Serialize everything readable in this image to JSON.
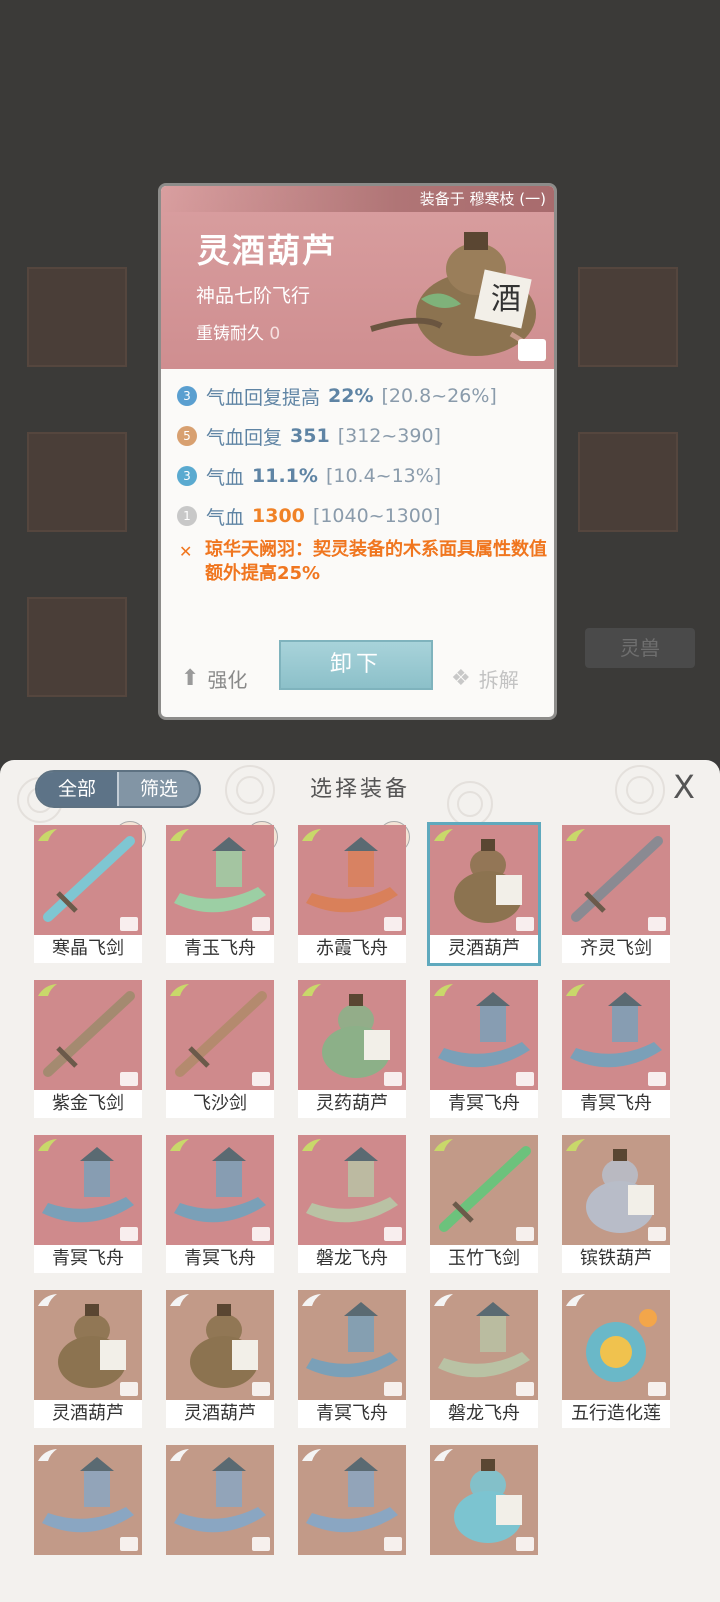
{
  "detail": {
    "equipped_by": "装备于 穆寒枝 (一)",
    "name": "灵酒葫芦",
    "grade": "神品七阶飞行",
    "durability_label": "重铸耐久",
    "durability_value": "0",
    "stats": [
      {
        "badge": "3",
        "badge_color": "#5a9fd0",
        "label": "气血回复提高",
        "value": "22%",
        "range": "[20.8~26%]",
        "value_color": "#5f84a4"
      },
      {
        "badge": "5",
        "badge_color": "#d8a070",
        "label": "气血回复",
        "value": "351",
        "range": "[312~390]",
        "value_color": "#5f84a4"
      },
      {
        "badge": "3",
        "badge_color": "#5aaad0",
        "label": "气血",
        "value": "11.1%",
        "range": "[10.4~13%]",
        "value_color": "#5f84a4"
      },
      {
        "badge": "1",
        "badge_color": "#c8c8c8",
        "label": "气血",
        "value": "1300",
        "range": "[1040~1300]",
        "value_color": "#f08227"
      }
    ],
    "special": "琼华天阙羽：契灵装备的木系面具属性数值额外提高25%",
    "strengthen": "强化",
    "unload": "卸下",
    "dismantle": "拆解"
  },
  "background": {
    "tag": "灵兽"
  },
  "panel": {
    "tab_all": "全部",
    "tab_filter": "筛选",
    "title": "选择装备",
    "close": "X"
  },
  "items": [
    {
      "name": "寒晶飞剑",
      "bg": "#cf8a8c",
      "kind": "sword",
      "tint": "#7fc6d2",
      "avatar": true
    },
    {
      "name": "青玉飞舟",
      "bg": "#cf8a8c",
      "kind": "boat",
      "tint": "#9ccfa4",
      "avatar": true
    },
    {
      "name": "赤霞飞舟",
      "bg": "#cf8a8c",
      "kind": "boat",
      "tint": "#d9805a",
      "avatar": true
    },
    {
      "name": "灵酒葫芦",
      "bg": "#cf8a8c",
      "kind": "gourd",
      "tint": "#8c7350",
      "selected": true
    },
    {
      "name": "齐灵飞剑",
      "bg": "#cf8a8c",
      "kind": "sword",
      "tint": "#8a8a92"
    },
    {
      "name": "紫金飞剑",
      "bg": "#cf8a8c",
      "kind": "sword",
      "tint": "#a48a70"
    },
    {
      "name": "飞沙剑",
      "bg": "#cf8a8c",
      "kind": "sword",
      "tint": "#b48a6e"
    },
    {
      "name": "灵药葫芦",
      "bg": "#cf8a8c",
      "kind": "gourd",
      "tint": "#8cb088"
    },
    {
      "name": "青冥飞舟",
      "bg": "#cf8a8c",
      "kind": "boat",
      "tint": "#7aa0b8"
    },
    {
      "name": "青冥飞舟",
      "bg": "#cf8a8c",
      "kind": "boat",
      "tint": "#7aa0b8"
    },
    {
      "name": "青冥飞舟",
      "bg": "#cf8a8c",
      "kind": "boat",
      "tint": "#7aa0b8"
    },
    {
      "name": "青冥飞舟",
      "bg": "#cf8a8c",
      "kind": "boat",
      "tint": "#7aa0b8"
    },
    {
      "name": "磐龙飞舟",
      "bg": "#cf8a8c",
      "kind": "boat",
      "tint": "#b9c2a4"
    },
    {
      "name": "玉竹飞剑",
      "bg": "#c29a88",
      "kind": "sword",
      "tint": "#6cc27c"
    },
    {
      "name": "镔铁葫芦",
      "bg": "#c29a88",
      "kind": "gourd",
      "tint": "#b8bcc8"
    },
    {
      "name": "灵酒葫芦",
      "bg": "#c29a88",
      "kind": "gourd",
      "tint": "#8c7350"
    },
    {
      "name": "灵酒葫芦",
      "bg": "#c29a88",
      "kind": "gourd",
      "tint": "#8c7350"
    },
    {
      "name": "青冥飞舟",
      "bg": "#c29a88",
      "kind": "boat",
      "tint": "#7aa0b8"
    },
    {
      "name": "磐龙飞舟",
      "bg": "#c29a88",
      "kind": "boat",
      "tint": "#b9c2a4"
    },
    {
      "name": "五行造化莲",
      "bg": "#c29a88",
      "kind": "lotus",
      "tint": "#6ab8c8"
    },
    {
      "name": "",
      "bg": "#c29a88",
      "kind": "boat",
      "tint": "#8aa6c2"
    },
    {
      "name": "",
      "bg": "#c29a88",
      "kind": "boat",
      "tint": "#8aa6c2"
    },
    {
      "name": "",
      "bg": "#c29a88",
      "kind": "boat",
      "tint": "#8aa6c2"
    },
    {
      "name": "",
      "bg": "#c29a88",
      "kind": "gourd",
      "tint": "#7cc4d0"
    }
  ]
}
